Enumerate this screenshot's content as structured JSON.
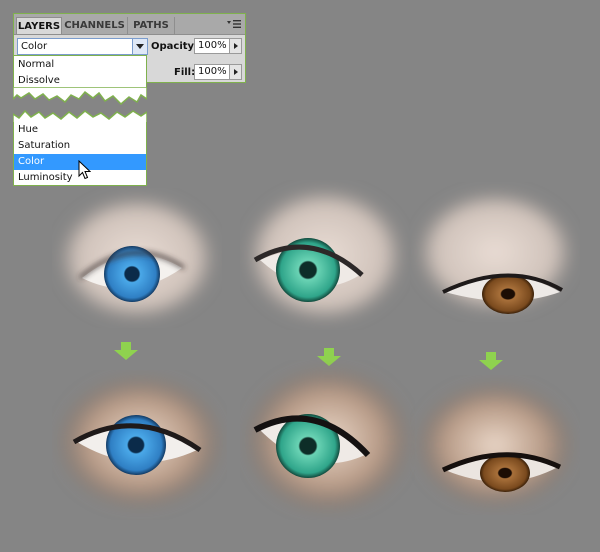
{
  "panel": {
    "tabs": [
      "LAYERS",
      "CHANNELS",
      "PATHS"
    ],
    "blend_mode": "Color",
    "opacity_label": "Opacity:",
    "opacity_value": "100%",
    "fill_label": "Fill:",
    "fill_value": "100%"
  },
  "menu_top": [
    "Normal",
    "Dissolve"
  ],
  "menu_bottom": [
    {
      "label": "Hue",
      "selected": false
    },
    {
      "label": "Saturation",
      "selected": false
    },
    {
      "label": "Color",
      "selected": true
    },
    {
      "label": "Luminosity",
      "selected": false
    }
  ],
  "colors": {
    "background": "#858585",
    "highlight": "#3399ff",
    "panel_border": "#7fb14d",
    "arrow": "#8fd24f",
    "iris_blue": "#2f7fc4",
    "iris_green": "#2fa58a",
    "iris_brown": "#7a4a1e"
  },
  "icons": [
    "panel-menu-icon",
    "dropdown-arrow-icon",
    "stepper-arrow-icon",
    "mouse-cursor-icon",
    "down-arrow-icon"
  ]
}
